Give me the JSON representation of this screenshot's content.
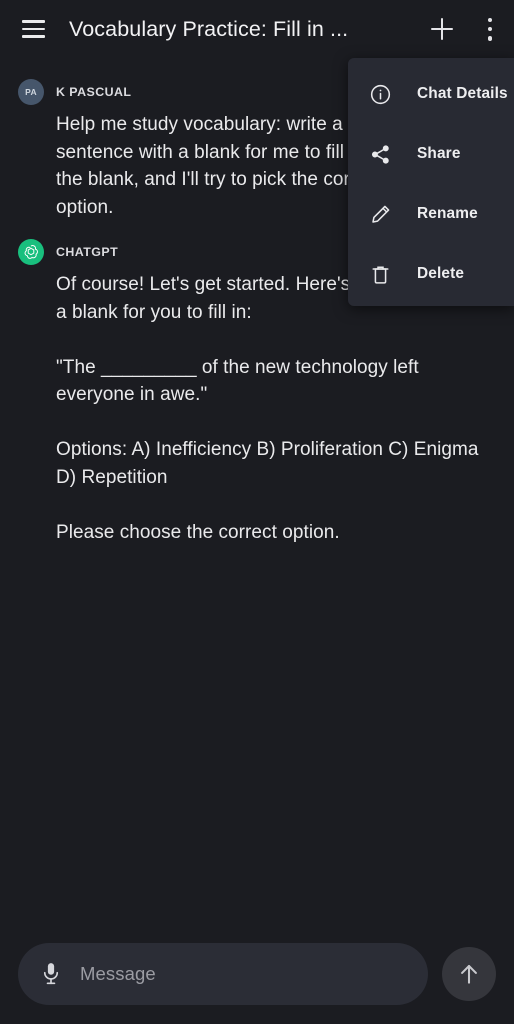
{
  "header": {
    "menu_icon": "hamburger-icon",
    "title": "Vocabulary Practice: Fill in ...",
    "new_chat_icon": "plus-icon",
    "overflow_icon": "kebab-icon"
  },
  "overflow_menu": {
    "items": [
      {
        "label": "Chat Details",
        "icon": "info-circle-icon"
      },
      {
        "label": "Share",
        "icon": "share-icon"
      },
      {
        "label": "Rename",
        "icon": "pencil-icon"
      },
      {
        "label": "Delete",
        "icon": "trash-icon"
      }
    ]
  },
  "conversation": {
    "messages": [
      {
        "sender": "K PASCUAL",
        "avatar_initials": "PA",
        "role": "user",
        "text": "Help me study vocabulary: write a sentence with a blank for me to fill in the blank, and I'll try to pick the correct option."
      },
      {
        "sender": "CHATGPT",
        "avatar_initials": "",
        "role": "assistant",
        "text": "Of course! Let's get started. Here's a sentence with a blank for you to fill in:\n\n\"The _________ of the new technology left everyone in awe.\"\n\nOptions: A) Inefficiency B) Proliferation C) Enigma D) Repetition\n\nPlease choose the correct option."
      }
    ]
  },
  "composer": {
    "mic_icon": "microphone-icon",
    "placeholder": "Message",
    "value": "",
    "send_icon": "arrow-up-icon"
  },
  "colors": {
    "background": "#1b1c21",
    "menu_background": "#282a33",
    "input_background": "#2b2d36",
    "accent_green": "#19bf7e",
    "user_avatar": "#46566b",
    "text_primary": "#eaeaec",
    "text_muted": "#9b9ca3"
  }
}
